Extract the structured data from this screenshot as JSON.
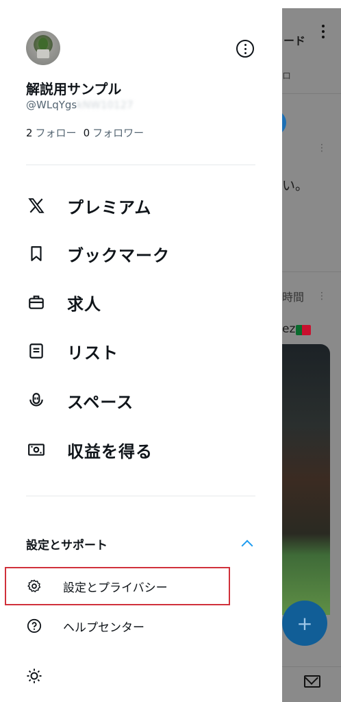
{
  "profile": {
    "display_name": "解説用サンプル",
    "handle": "@WLqYgs",
    "handle_hidden": "kNW10127",
    "following_count": "2",
    "following_label": "フォロー",
    "followers_count": "0",
    "followers_label": "フォロワー"
  },
  "nav": {
    "items": [
      {
        "label": "プレミアム",
        "icon": "x-logo-icon"
      },
      {
        "label": "ブックマーク",
        "icon": "bookmark-icon"
      },
      {
        "label": "求人",
        "icon": "briefcase-icon"
      },
      {
        "label": "リスト",
        "icon": "list-icon"
      },
      {
        "label": "スペース",
        "icon": "spaces-icon"
      },
      {
        "label": "収益を得る",
        "icon": "money-icon"
      }
    ]
  },
  "settings_section": {
    "title": "設定とサポート",
    "items": [
      {
        "label": "設定とプライバシー",
        "icon": "gear-icon"
      },
      {
        "label": "ヘルプセンター",
        "icon": "help-icon"
      },
      {
        "label": "",
        "icon": "sun-icon"
      }
    ]
  },
  "background": {
    "tab_label": "ード",
    "sub_label": "ロ",
    "post_text_fragment": "い。",
    "post_time": "時間",
    "post_author_fragment": "ez",
    "fab_symbol": "+"
  },
  "colors": {
    "accent": "#1d9bf0",
    "highlight_border": "#d0303a",
    "text_primary": "#0f1419",
    "text_secondary": "#536471"
  }
}
